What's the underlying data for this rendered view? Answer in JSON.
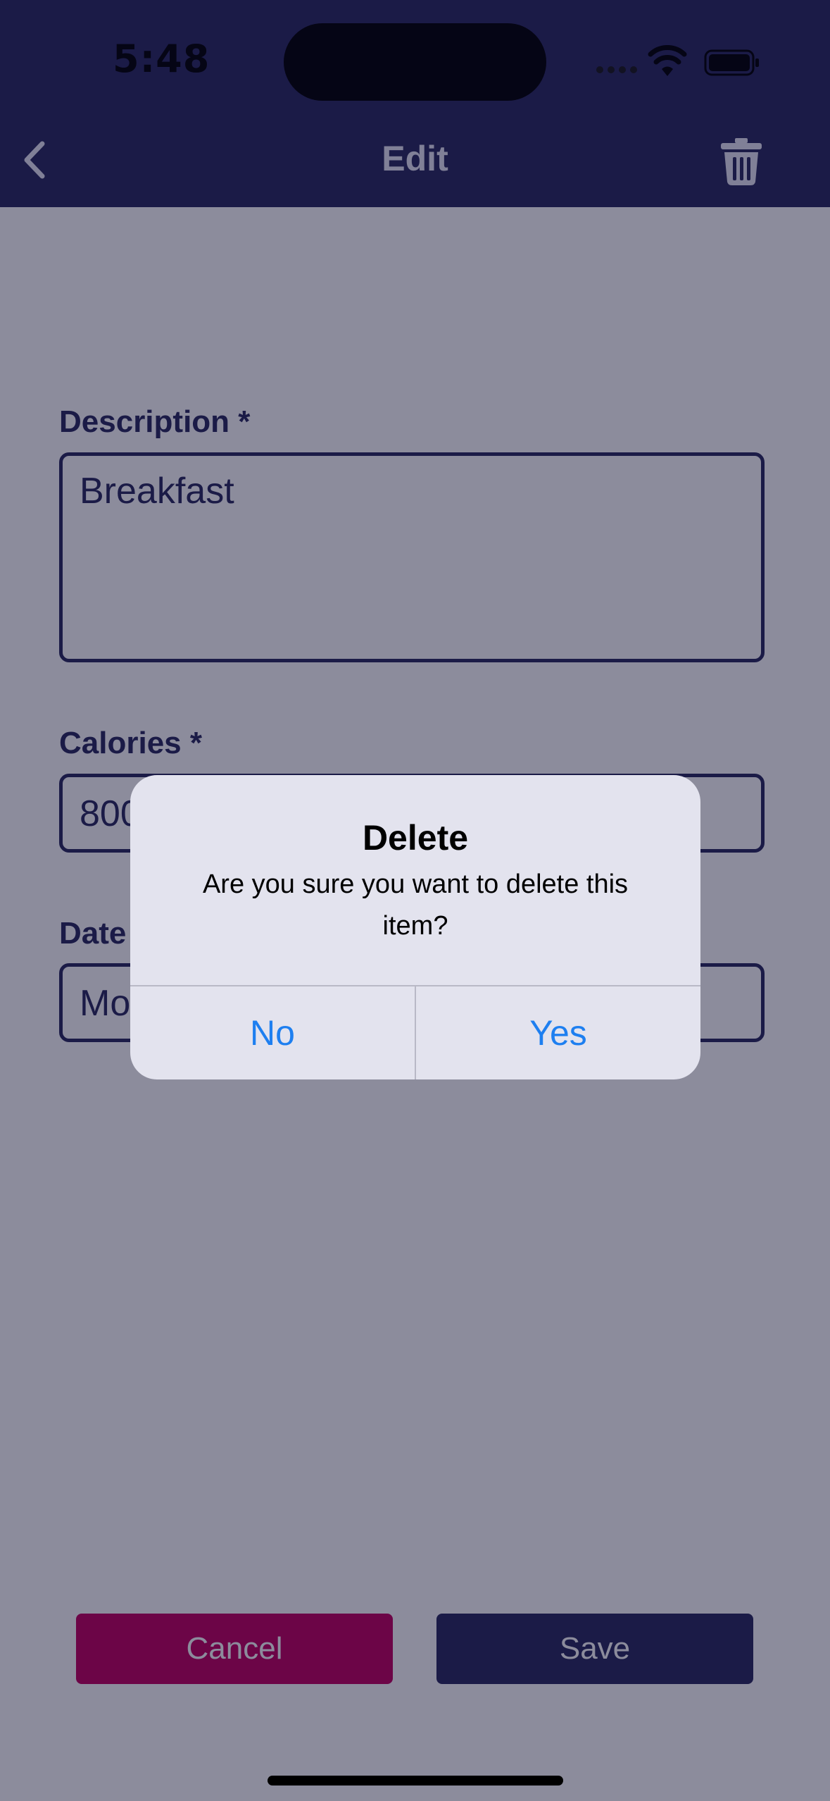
{
  "status_bar": {
    "time": "5:48"
  },
  "nav": {
    "title": "Edit",
    "back_icon": "chevron-left-icon",
    "delete_icon": "trash-icon"
  },
  "form": {
    "description": {
      "label": "Description *",
      "value": "Breakfast"
    },
    "calories": {
      "label": "Calories *",
      "value": "800"
    },
    "date": {
      "label": "Date",
      "value": "Mo"
    }
  },
  "buttons": {
    "cancel": "Cancel",
    "save": "Save"
  },
  "alert": {
    "title": "Delete",
    "message": "Are you sure you want to delete this item?",
    "no": "No",
    "yes": "Yes"
  },
  "colors": {
    "primary": "#2b2a5f",
    "danger": "#c2005f",
    "link": "#1e7ff0",
    "alert_bg": "#e3e3ee"
  }
}
